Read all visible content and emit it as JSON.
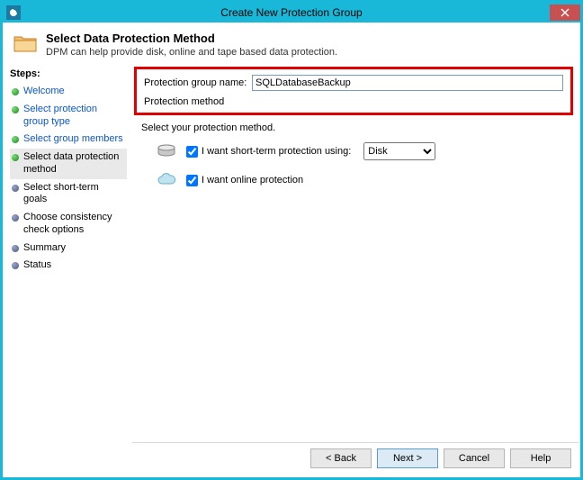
{
  "window": {
    "title": "Create New Protection Group"
  },
  "header": {
    "title": "Select Data Protection Method",
    "subtitle": "DPM can help provide disk, online and tape based data protection."
  },
  "sidebar": {
    "heading": "Steps:",
    "items": [
      {
        "label": "Welcome",
        "state": "done",
        "link": true
      },
      {
        "label": "Select protection group type",
        "state": "done",
        "link": true
      },
      {
        "label": "Select group members",
        "state": "done",
        "link": true
      },
      {
        "label": "Select data protection method",
        "state": "current",
        "link": false
      },
      {
        "label": "Select short-term goals",
        "state": "todo",
        "link": false
      },
      {
        "label": "Choose consistency check options",
        "state": "todo",
        "link": false
      },
      {
        "label": "Summary",
        "state": "todo",
        "link": false
      },
      {
        "label": "Status",
        "state": "todo",
        "link": false
      }
    ]
  },
  "form": {
    "group_name_label": "Protection group name:",
    "group_name_value": "SQLDatabaseBackup",
    "method_heading": "Protection method",
    "select_prompt": "Select your protection method.",
    "short_term_label": "I want short-term protection using:",
    "short_term_checked": true,
    "short_term_media_selected": "Disk",
    "online_label": "I want online protection",
    "online_checked": true
  },
  "buttons": {
    "back": "< Back",
    "next": "Next >",
    "cancel": "Cancel",
    "help": "Help"
  }
}
